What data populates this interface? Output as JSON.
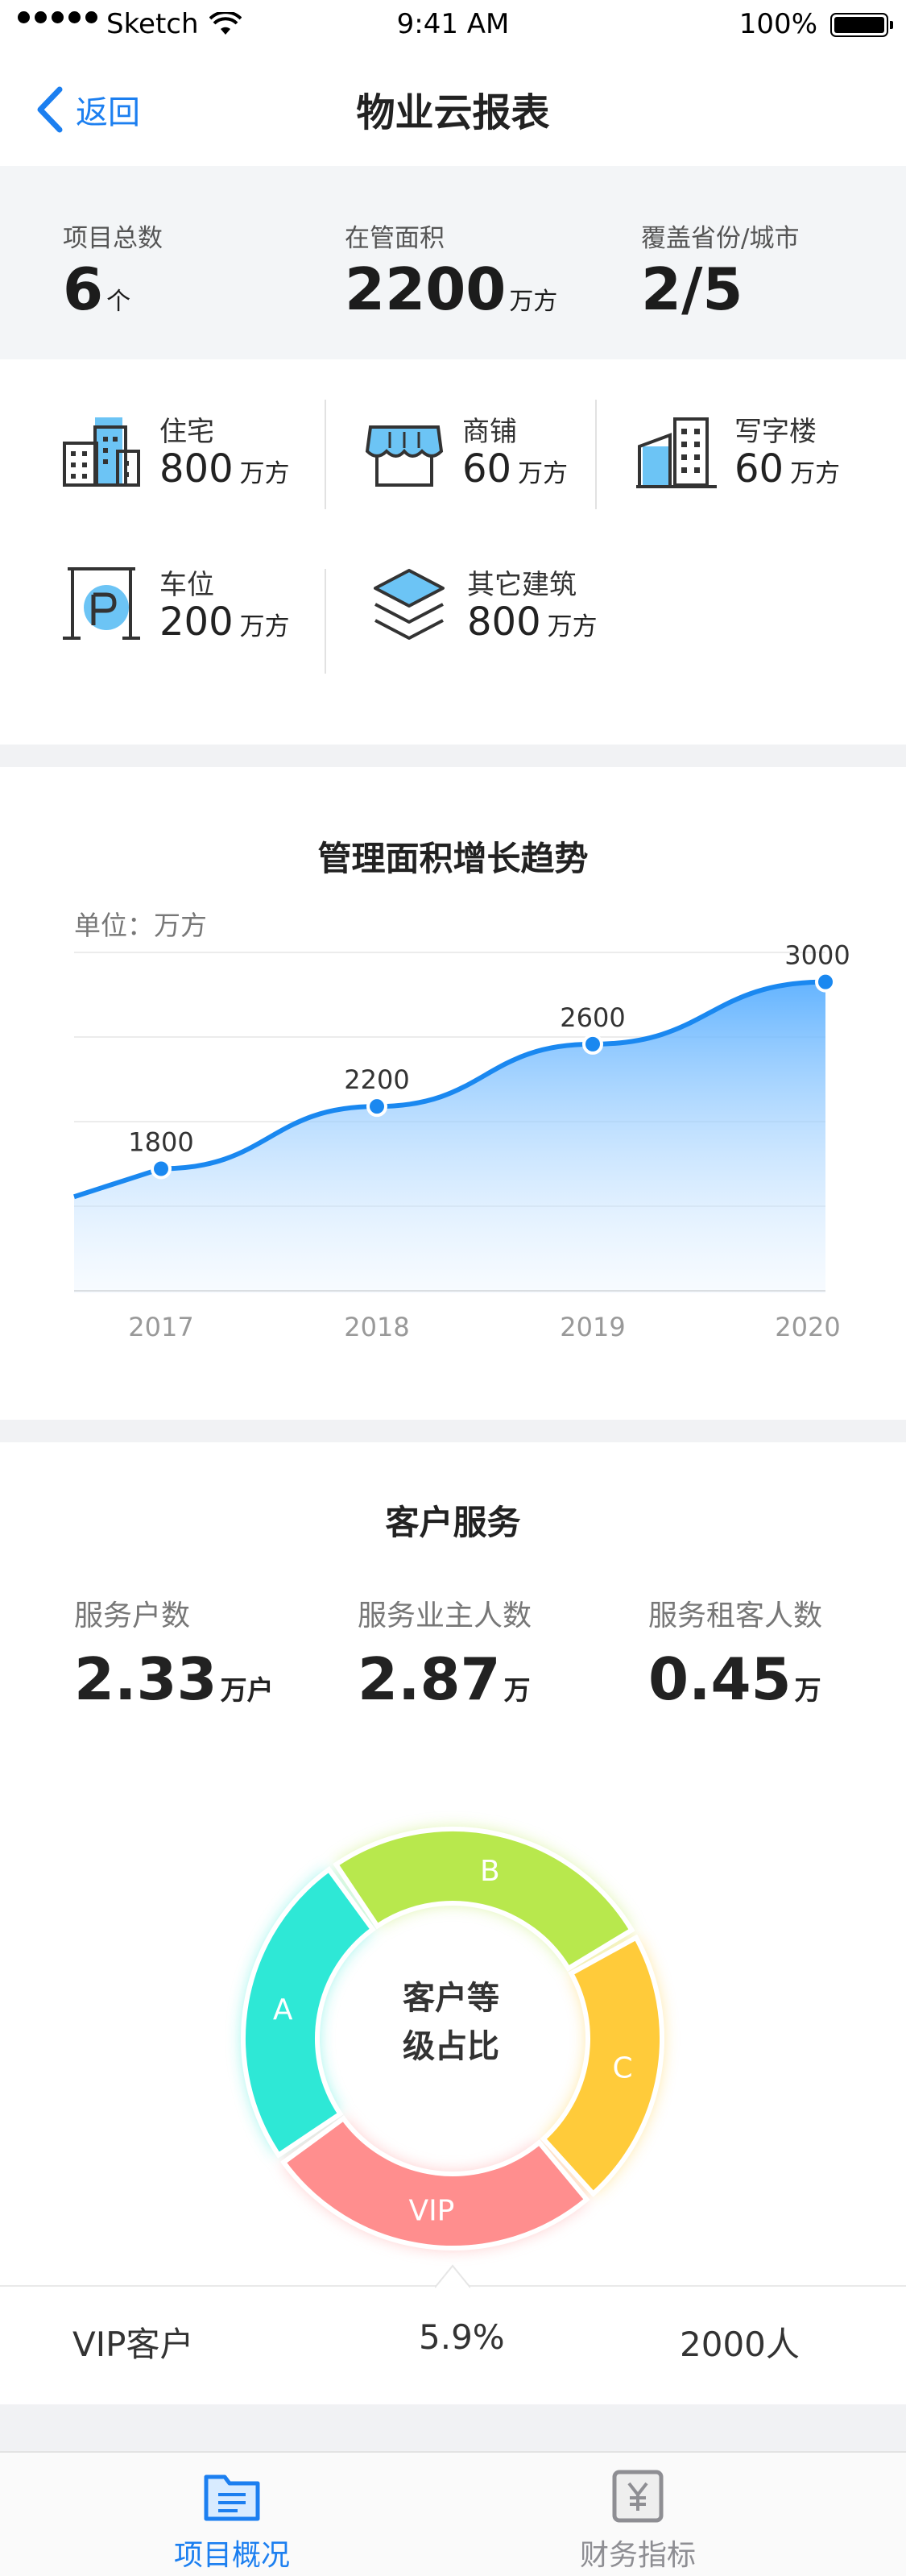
{
  "status_bar": {
    "carrier": "Sketch",
    "time": "9:41 AM",
    "battery": "100%"
  },
  "nav": {
    "back_label": "返回",
    "title": "物业云报表"
  },
  "summary": [
    {
      "label": "项目总数",
      "value": "6",
      "unit": "个"
    },
    {
      "label": "在管面积",
      "value": "2200",
      "unit": "万方"
    },
    {
      "label": "覆盖省份/城市",
      "value": "2/5",
      "unit": ""
    }
  ],
  "categories": [
    {
      "label": "住宅",
      "value": "800",
      "unit": "万方",
      "icon": "residential-building-icon"
    },
    {
      "label": "商铺",
      "value": "60",
      "unit": "万方",
      "icon": "shop-icon"
    },
    {
      "label": "写字楼",
      "value": "60",
      "unit": "万方",
      "icon": "office-building-icon"
    },
    {
      "label": "车位",
      "value": "200",
      "unit": "万方",
      "icon": "parking-icon"
    },
    {
      "label": "其它建筑",
      "value": "800",
      "unit": "万方",
      "icon": "layers-icon"
    }
  ],
  "growth": {
    "title": "管理面积增长趋势",
    "unit_label": "单位：万方"
  },
  "chart_data": {
    "type": "area",
    "title": "管理面积增长趋势",
    "ylabel": "单位：万方",
    "x": [
      "2017",
      "2018",
      "2019",
      "2020"
    ],
    "series": [
      {
        "values": [
          1800,
          2200,
          2600,
          3000
        ]
      }
    ],
    "data_labels": [
      "1800",
      "2200",
      "2600",
      "3000"
    ],
    "ylim": [
      1000,
      3200
    ],
    "grid": true
  },
  "service": {
    "title": "客户服务",
    "stats": [
      {
        "label": "服务户数",
        "value": "2.33",
        "unit": "万户"
      },
      {
        "label": "服务业主人数",
        "value": "2.87",
        "unit": "万"
      },
      {
        "label": "服务租客人数",
        "value": "0.45",
        "unit": "万"
      }
    ],
    "donut_center_line1": "客户等",
    "donut_center_line2": "级占比",
    "segments": [
      {
        "label": "A",
        "color": "#2ee8d6"
      },
      {
        "label": "B",
        "color": "#b8e84d"
      },
      {
        "label": "C",
        "color": "#ffcb3a"
      },
      {
        "label": "VIP",
        "color": "#ff8e8e"
      }
    ],
    "selected": {
      "name": "VIP客户",
      "percent": "5.9%",
      "count": "2000人"
    }
  },
  "tabs": [
    {
      "label": "项目概况",
      "active": true,
      "color": "#1c7ff0",
      "icon": "project-folder-icon"
    },
    {
      "label": "财务指标",
      "active": false,
      "color": "#8e8e93",
      "icon": "finance-yen-icon"
    }
  ]
}
